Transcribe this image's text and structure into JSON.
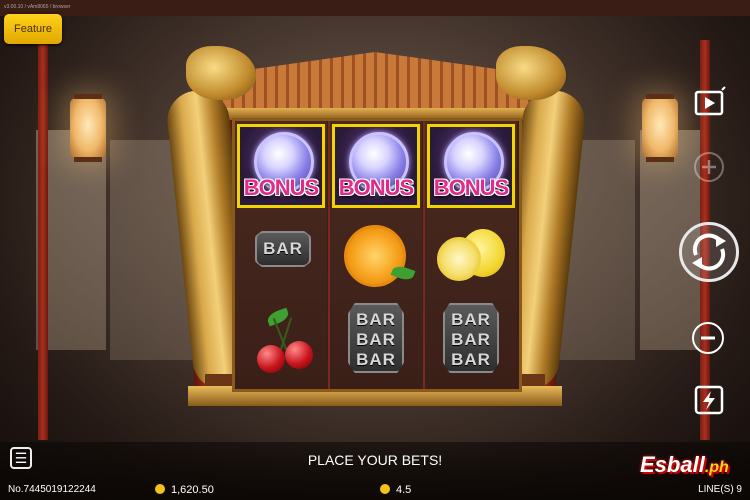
{
  "debug_text": "v3.00.10 / vAm8065 / browser",
  "feature_button": "Feature",
  "reels": [
    {
      "symbols": [
        "BONUS",
        "BAR",
        "cherry"
      ]
    },
    {
      "symbols": [
        "BONUS",
        "orange",
        "BAR BAR BAR"
      ]
    },
    {
      "symbols": [
        "BONUS",
        "lemon",
        "BAR BAR BAR"
      ]
    }
  ],
  "bonus_label": "BONUS",
  "bar_label": "BAR",
  "status_message": "PLACE YOUR BETS!",
  "round_number": "No.7445019122244",
  "balance": "1,620.50",
  "bet": "4.5",
  "lines": "LINE(S) 9",
  "logo": {
    "main": "Esball",
    "suffix": ".ph"
  },
  "icons": {
    "autoplay": "play-screen-icon",
    "bet_increase": "plus-icon",
    "spin": "spin-icon",
    "bet_decrease": "minus-icon",
    "turbo": "lightning-icon",
    "menu": "menu-icon",
    "balance": "coin-stack-icon",
    "bet": "coin-icon"
  },
  "colors": {
    "feature_button": "#ffd21a",
    "bonus_text": "#e02b8a",
    "bonus_border": "#f1d400"
  }
}
